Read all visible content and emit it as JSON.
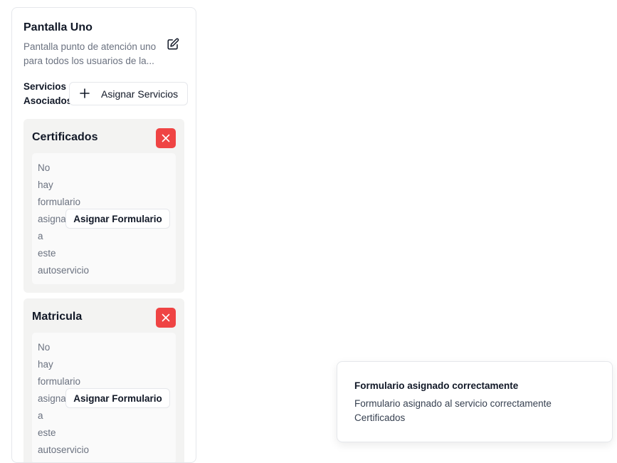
{
  "screen": {
    "title": "Pantalla Uno",
    "description_line1": "Pantalla punto de atención uno",
    "description_line2": "para todos los usuarios de la..."
  },
  "services_section": {
    "label_line1": "Servicios",
    "label_line2": "Asociados",
    "assign_button_label": "Asignar Servicios"
  },
  "services": [
    {
      "name": "Certificados",
      "no_form_lines": [
        "No",
        "hay",
        "formulario",
        "asignado",
        "a",
        "este",
        "autoservicio"
      ],
      "assign_form_label": "Asignar Formulario"
    },
    {
      "name": "Matricula",
      "no_form_lines": [
        "No",
        "hay",
        "formulario",
        "asignado",
        "a",
        "este",
        "autoservicio"
      ],
      "assign_form_label": "Asignar Formulario"
    }
  ],
  "toast": {
    "title": "Formulario asignado correctamente",
    "body_line1": "Formulario asignado al servicio correctamente",
    "body_line2": "Certificados"
  },
  "colors": {
    "danger": "#ef4444",
    "card_bg": "#f3f3f2",
    "muted_text": "#6b7280"
  },
  "icons": {
    "edit": "edit-square-pen-icon",
    "add": "plus-icon",
    "remove": "close-icon"
  }
}
